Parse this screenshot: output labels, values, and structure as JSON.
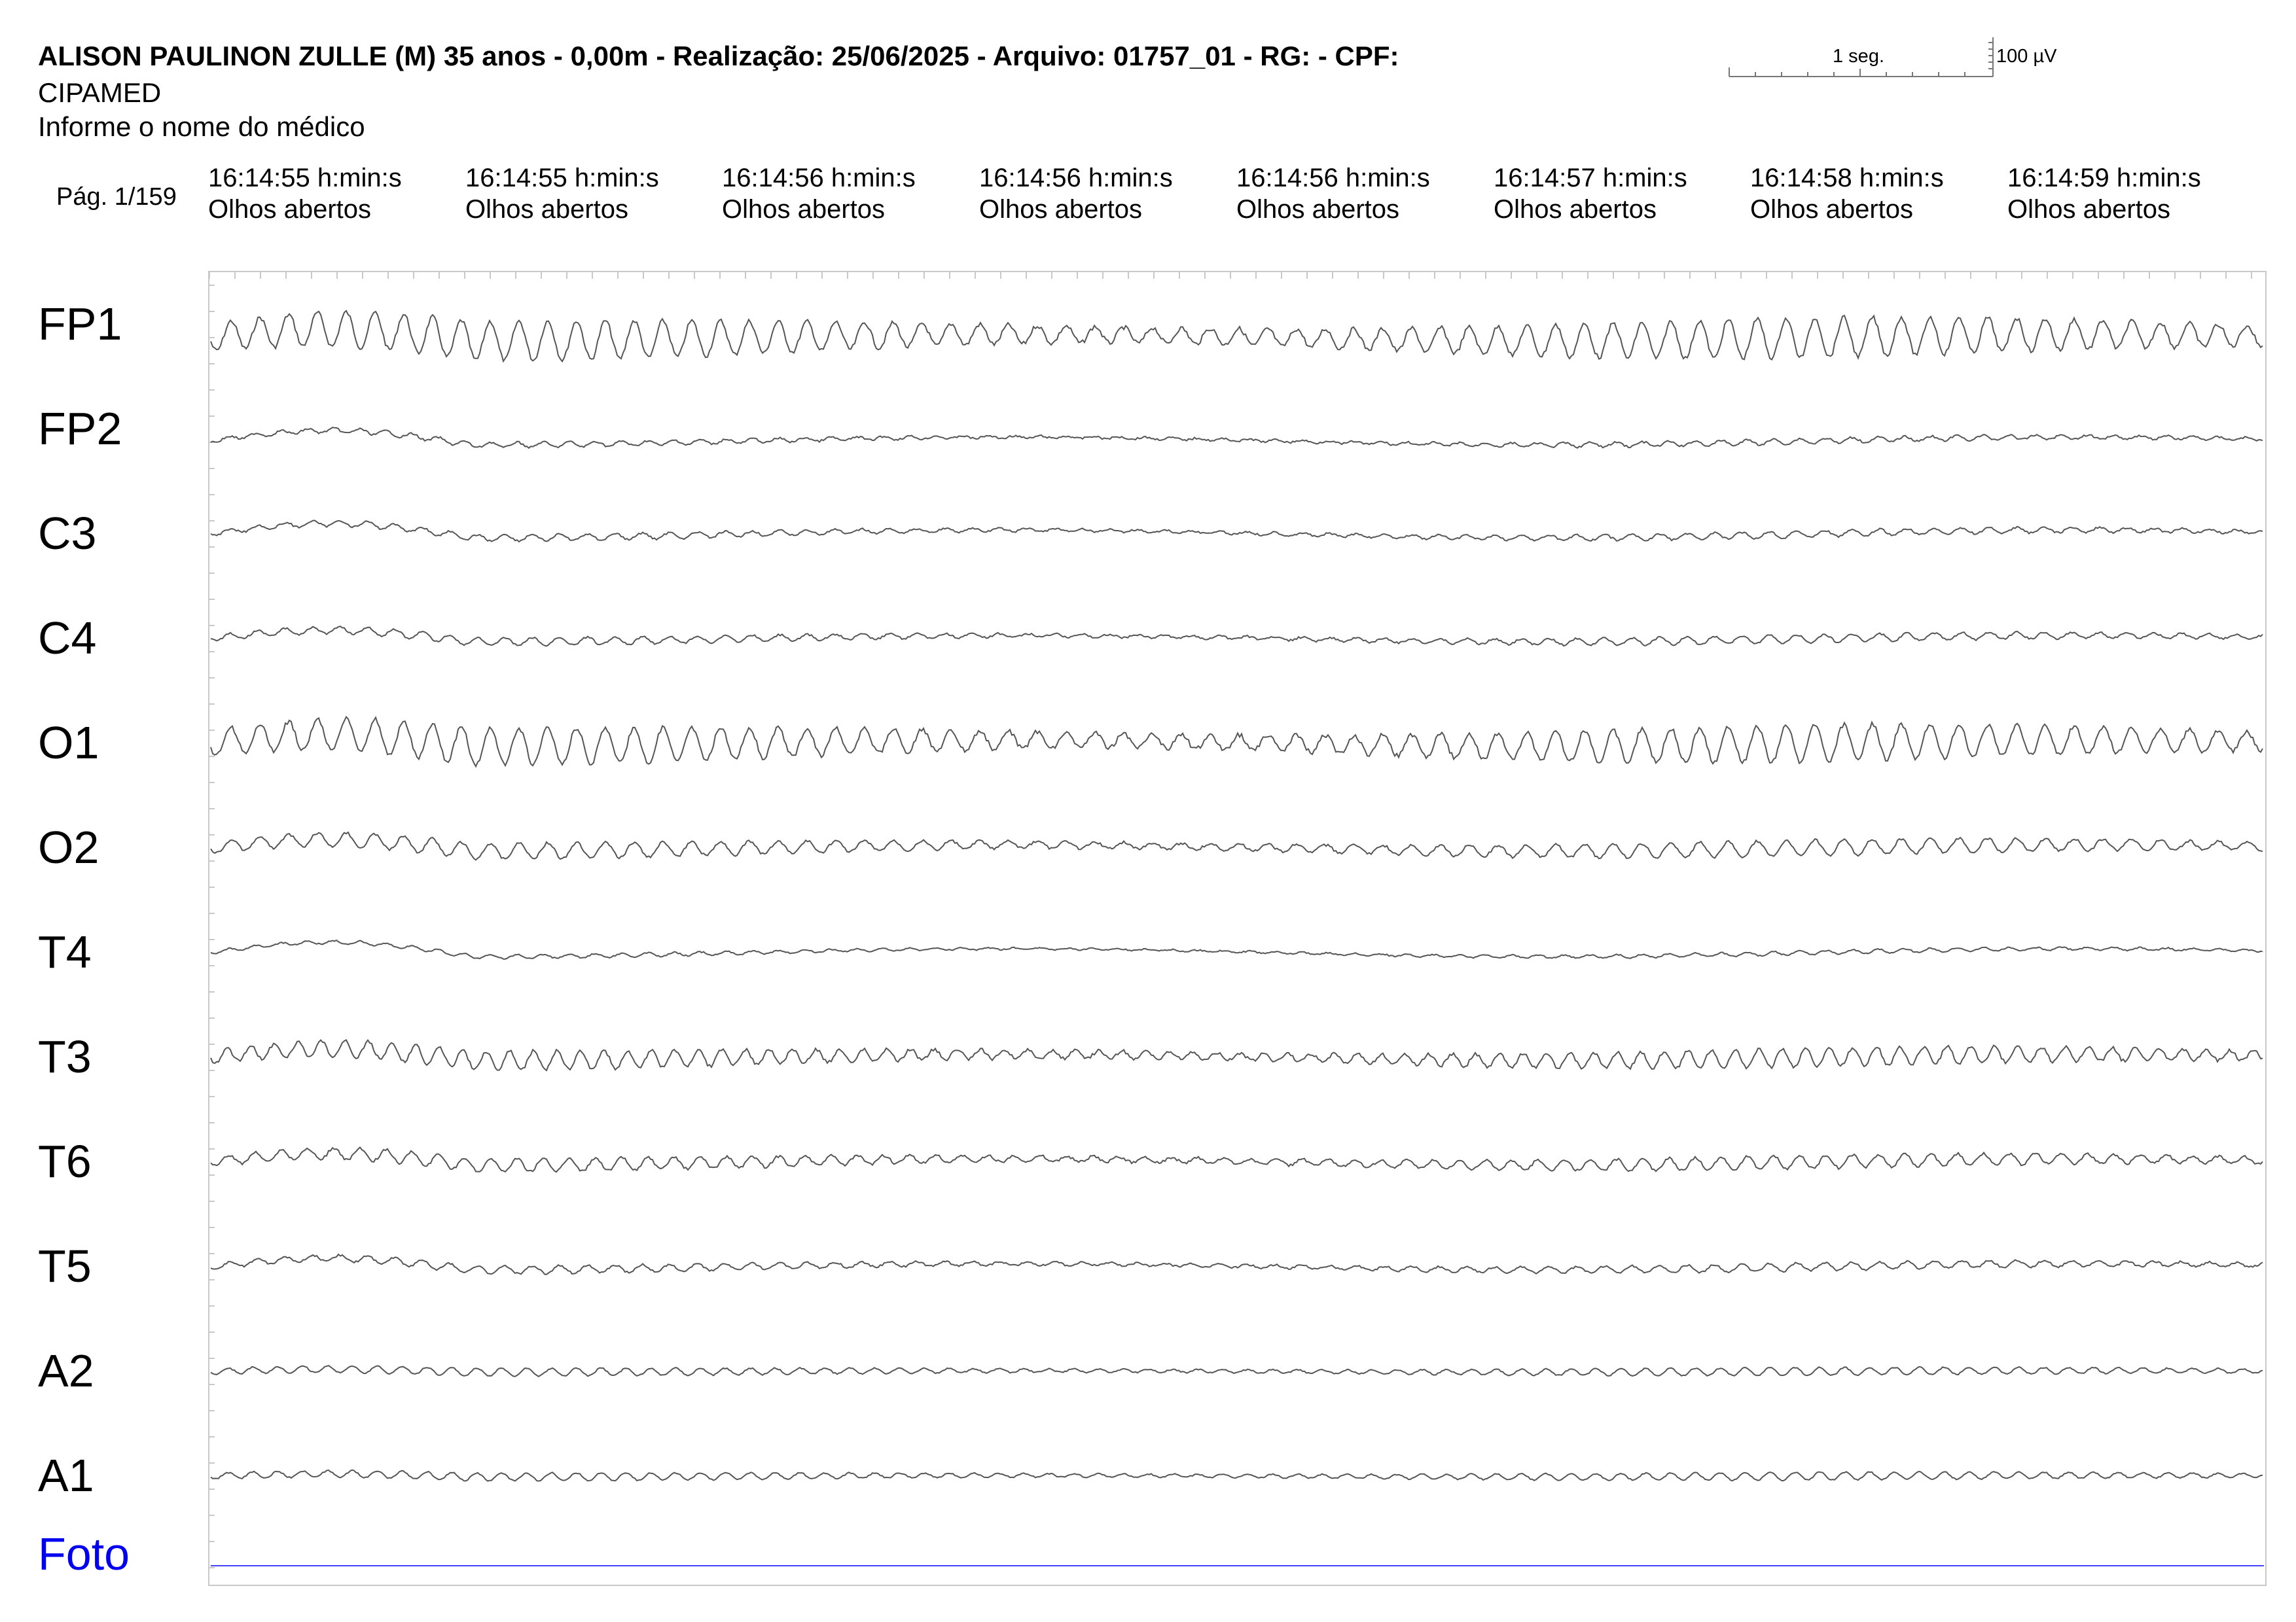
{
  "header": {
    "title": "ALISON PAULINON ZULLE (M) 35 anos - 0,00m - Realização: 25/06/2025 - Arquivo: 01757_01 - RG:  - CPF:",
    "clinic": "CIPAMED",
    "doctor": "Informe o nome do médico"
  },
  "scale": {
    "time_label": "1 seg.",
    "amplitude_label": "100 µV"
  },
  "page": "Pág. 1/159",
  "timestamps": [
    {
      "time": "16:14:55 h:min:s",
      "state": "Olhos abertos"
    },
    {
      "time": "16:14:55 h:min:s",
      "state": "Olhos abertos"
    },
    {
      "time": "16:14:56 h:min:s",
      "state": "Olhos abertos"
    },
    {
      "time": "16:14:56 h:min:s",
      "state": "Olhos abertos"
    },
    {
      "time": "16:14:56 h:min:s",
      "state": "Olhos abertos"
    },
    {
      "time": "16:14:57 h:min:s",
      "state": "Olhos abertos"
    },
    {
      "time": "16:14:58 h:min:s",
      "state": "Olhos abertos"
    },
    {
      "time": "16:14:59 h:min:s",
      "state": "Olhos abertos"
    }
  ],
  "channels": [
    {
      "label": "FP1",
      "color": "#555555"
    },
    {
      "label": "FP2",
      "color": "#555555"
    },
    {
      "label": "C3",
      "color": "#555555"
    },
    {
      "label": "C4",
      "color": "#555555"
    },
    {
      "label": "O1",
      "color": "#555555"
    },
    {
      "label": "O2",
      "color": "#555555"
    },
    {
      "label": "T4",
      "color": "#555555"
    },
    {
      "label": "T3",
      "color": "#555555"
    },
    {
      "label": "T6",
      "color": "#555555"
    },
    {
      "label": "T5",
      "color": "#555555"
    },
    {
      "label": "A2",
      "color": "#555555"
    },
    {
      "label": "A1",
      "color": "#555555"
    },
    {
      "label": "Foto",
      "color": "#4444ff"
    }
  ]
}
